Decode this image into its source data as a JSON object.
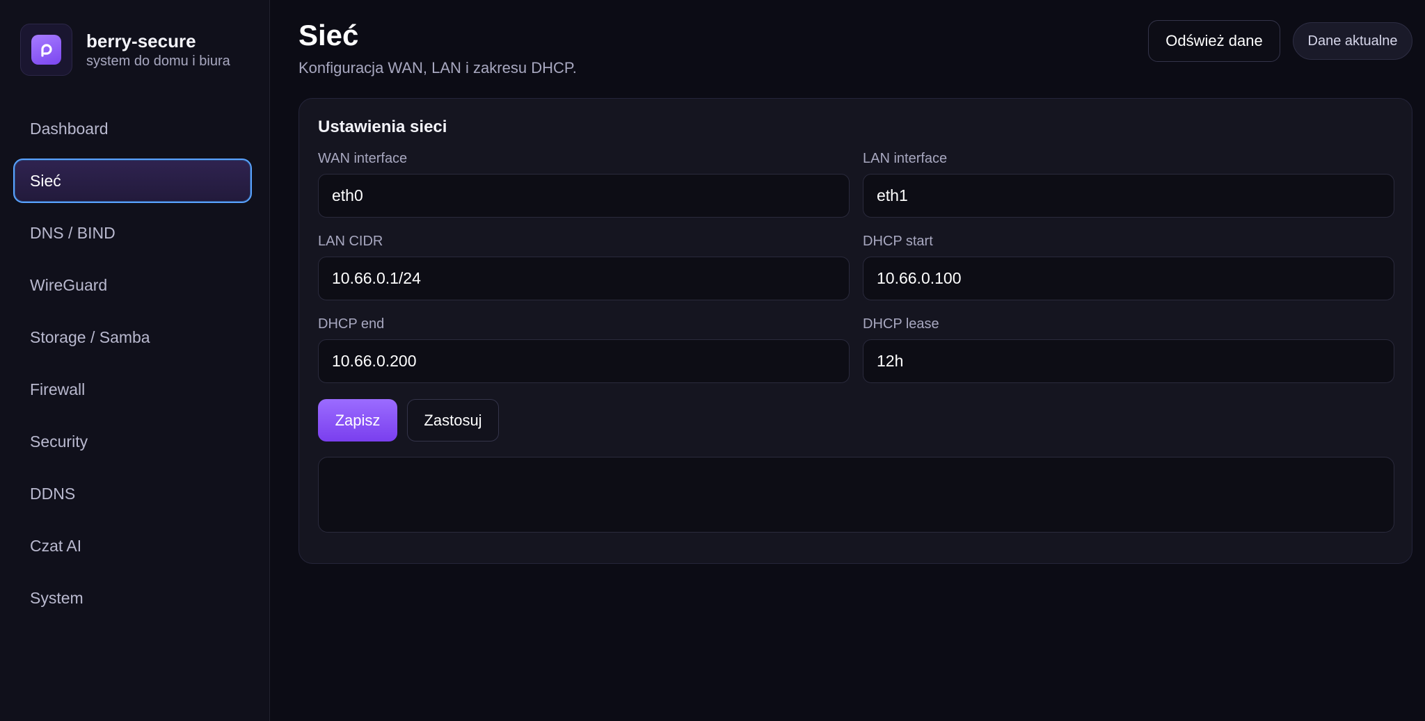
{
  "brand": {
    "name": "berry-secure",
    "subtitle": "system do domu i biura",
    "logo_icon": "berry-logo-icon"
  },
  "sidebar": {
    "items": [
      {
        "label": "Dashboard",
        "active": false
      },
      {
        "label": "Sieć",
        "active": true
      },
      {
        "label": "DNS / BIND",
        "active": false
      },
      {
        "label": "WireGuard",
        "active": false
      },
      {
        "label": "Storage / Samba",
        "active": false
      },
      {
        "label": "Firewall",
        "active": false
      },
      {
        "label": "Security",
        "active": false
      },
      {
        "label": "DDNS",
        "active": false
      },
      {
        "label": "Czat AI",
        "active": false
      },
      {
        "label": "System",
        "active": false
      }
    ]
  },
  "header": {
    "title": "Sieć",
    "subtitle": "Konfiguracja WAN, LAN i zakresu DHCP.",
    "refresh_label": "Odśwież dane",
    "status_label": "Dane aktualne"
  },
  "card": {
    "title": "Ustawienia sieci",
    "fields": {
      "wan_interface": {
        "label": "WAN interface",
        "value": "eth0"
      },
      "lan_interface": {
        "label": "LAN interface",
        "value": "eth1"
      },
      "lan_cidr": {
        "label": "LAN CIDR",
        "value": "10.66.0.1/24"
      },
      "dhcp_start": {
        "label": "DHCP start",
        "value": "10.66.0.100"
      },
      "dhcp_end": {
        "label": "DHCP end",
        "value": "10.66.0.200"
      },
      "dhcp_lease": {
        "label": "DHCP lease",
        "value": "12h"
      }
    },
    "save_label": "Zapisz",
    "apply_label": "Zastosuj",
    "output": ""
  },
  "colors": {
    "accent": "#8b5cf6",
    "active_border": "#5aa2ff",
    "background": "#0c0c15",
    "sidebar_bg": "#10101b",
    "card_bg": "#151520"
  }
}
